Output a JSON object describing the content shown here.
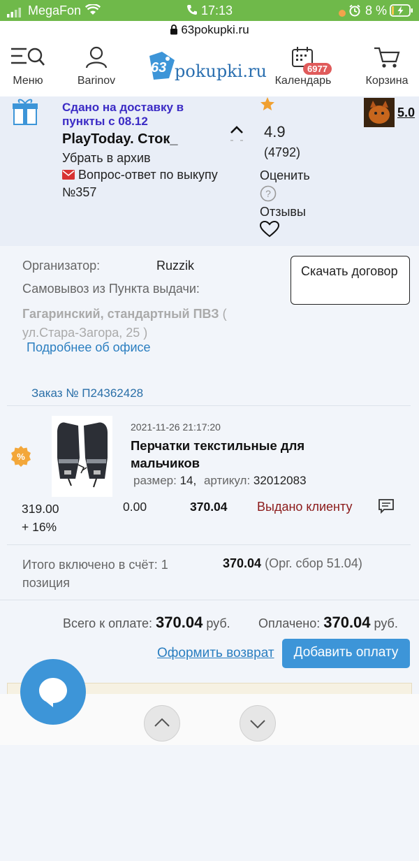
{
  "status": {
    "carrier": "MegaFon",
    "time": "17:13",
    "battery": "8 %"
  },
  "url": {
    "domain": "63pokupki.ru"
  },
  "nav": {
    "menu": "Меню",
    "user": "Barinov",
    "logo_a": "63",
    "logo_b": "pokupki.ru",
    "calendar": "Календарь",
    "calendar_badge": "6977",
    "cart": "Корзина"
  },
  "purchase": {
    "delivery_status": "Сдано на доставку в пункты с 08.12",
    "title": "PlayToday. Сток_",
    "archive": "Убрать в архив",
    "qa": "Вопрос-ответ по выкупу",
    "number": "№357",
    "rating": "4.9",
    "rating_count": "(4792)",
    "rate_label": "Оценить",
    "reviews_label": "Отзывы",
    "organizer_rating": "5.0"
  },
  "organizer": {
    "label": "Организатор:",
    "name": "Ruzzik",
    "download_contract": "Скачать договор",
    "pickup_label": "Самовывоз из Пункта выдачи:",
    "pickup_point": "Гагаринский, стандартный ПВЗ",
    "pickup_address": "( ул.Стара-Загора, 25 )",
    "office_link": "Подробнее об офисе"
  },
  "order": {
    "number": "Заказ № П24362428",
    "item": {
      "datetime": "2021-11-26 21:17:20",
      "title": "Перчатки текстильные для мальчиков",
      "size_label": "размер:",
      "size_value": "14,",
      "article_label": "артикул:",
      "article_value": "32012083",
      "price": "319.00",
      "percent": "+ 16%",
      "delivery": "0.00",
      "total": "370.04",
      "status": "Выдано клиенту",
      "discount_badge": "%"
    },
    "summary_label": "Итого включено в счёт: 1 позиция",
    "summary_total": "370.04",
    "summary_fee": "(Орг. сбор 51.04)",
    "to_pay_label": "Всего к оплате:",
    "to_pay_value": "370.04",
    "paid_label": "Оплачено:",
    "paid_value": "370.04",
    "currency": "руб.",
    "return_link": "Оформить возврат",
    "add_payment": "Добавить оплату"
  },
  "colors": {
    "status_green": "#6fb94a",
    "accent_blue": "#3d95d8",
    "status_red": "#8b1a1a",
    "purple_text": "#3b2bc5"
  }
}
